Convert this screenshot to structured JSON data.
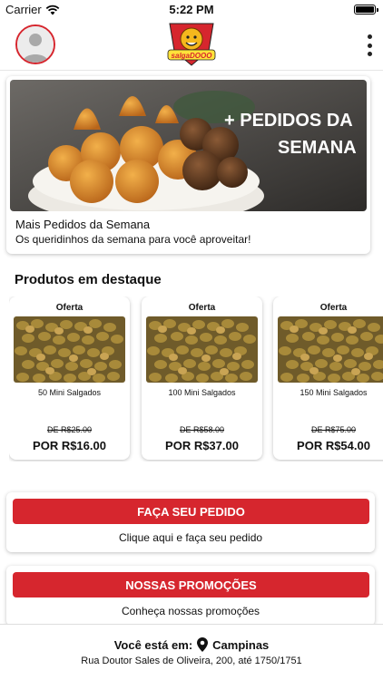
{
  "status_bar": {
    "carrier": "Carrier",
    "time": "5:22 PM",
    "wifi_icon": "wifi-icon",
    "battery_icon": "battery-icon"
  },
  "header": {
    "avatar_icon": "user-avatar-icon",
    "logo_text": "salgaDOOO",
    "menu_icon": "more-vertical-icon"
  },
  "banner": {
    "overlay_line1": "+ PEDIDOS DA",
    "overlay_line2": "SEMANA",
    "title": "Mais Pedidos da Semana",
    "subtitle": "Os queridinhos da semana para você aproveitar!"
  },
  "featured": {
    "title": "Produtos em destaque",
    "products": [
      {
        "badge": "Oferta",
        "name": "50 Mini Salgados",
        "old_price": "DE R$25.00",
        "price": "POR R$16.00"
      },
      {
        "badge": "Oferta",
        "name": "100 Mini Salgados",
        "old_price": "DE R$58.00",
        "price": "POR R$37.00"
      },
      {
        "badge": "Oferta",
        "name": "150 Mini Salgados",
        "old_price": "DE R$75.00",
        "price": "POR R$54.00"
      }
    ]
  },
  "order": {
    "button": "FAÇA SEU PEDIDO",
    "subtitle": "Clique aqui e faça seu pedido"
  },
  "promos": {
    "button": "NOSSAS PROMOÇÕES",
    "subtitle": "Conheça nossas promoções"
  },
  "location": {
    "prefix": "Você está em:",
    "icon": "map-pin-icon",
    "city": "Campinas",
    "address": "Rua Doutor Sales de Oliveira, 200, até 1750/1751"
  },
  "colors": {
    "accent": "#d6262e",
    "text": "#111111",
    "background": "#ffffff"
  }
}
